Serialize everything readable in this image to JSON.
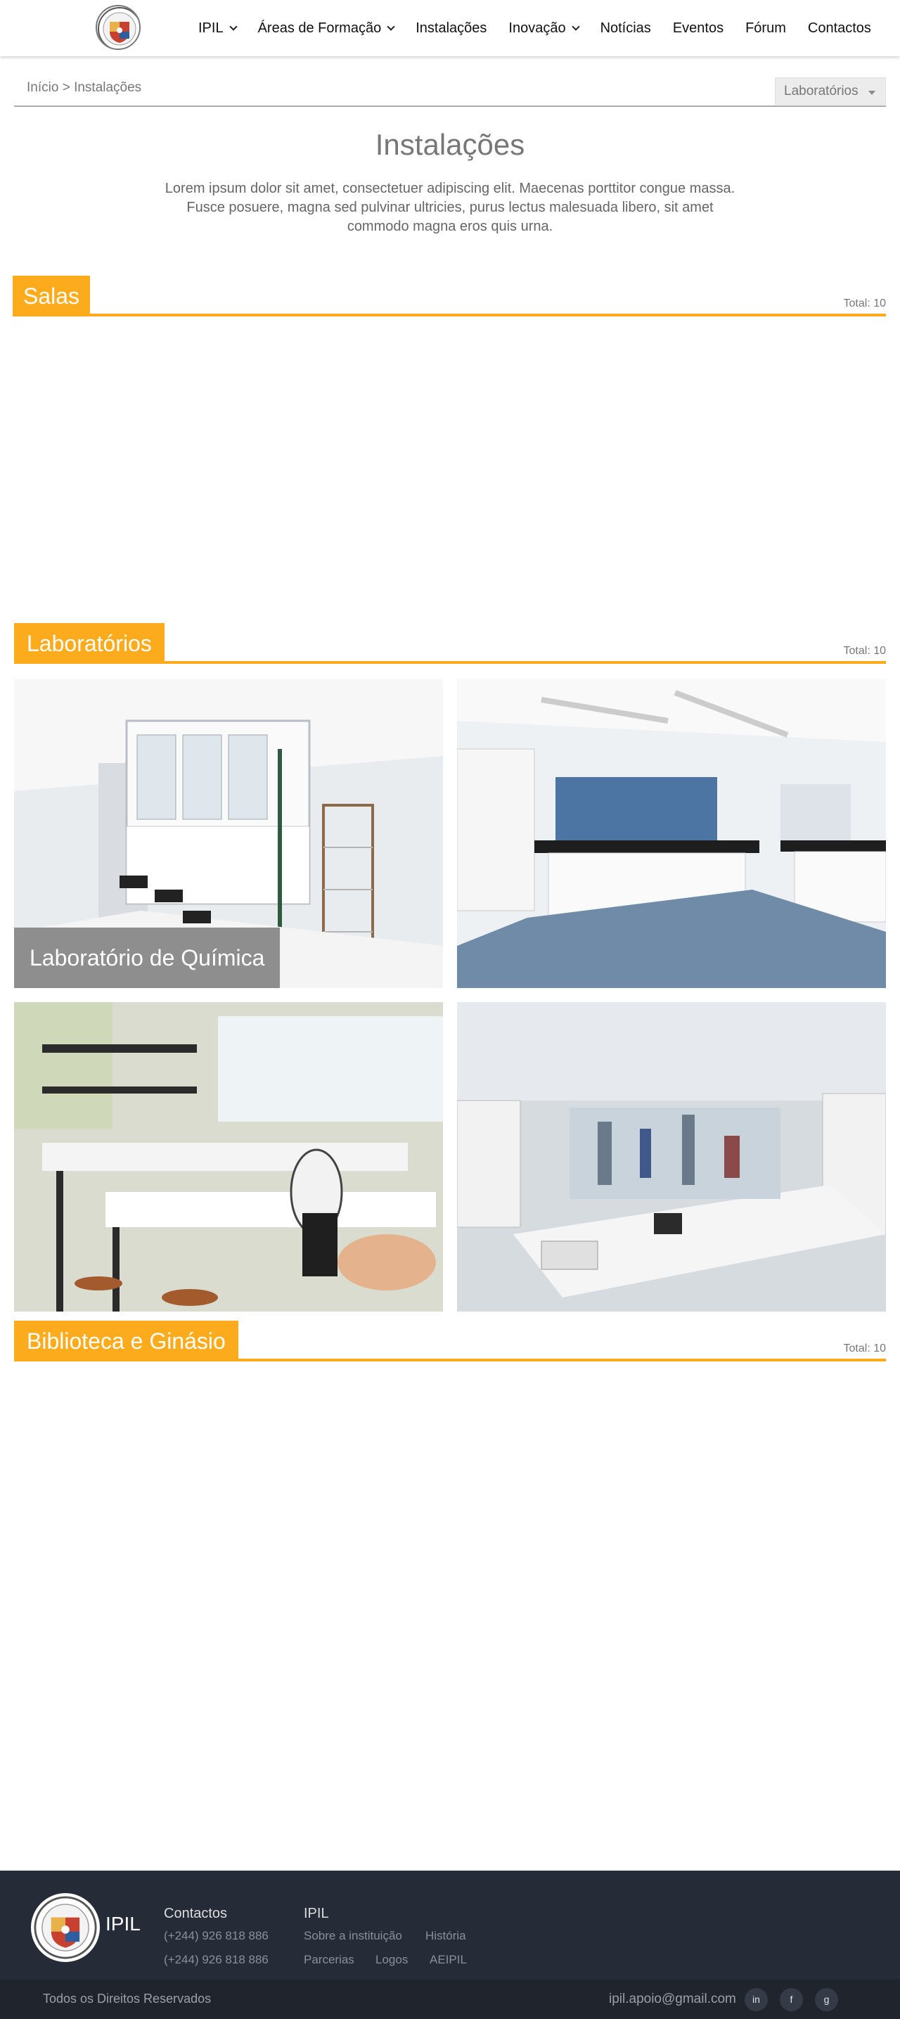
{
  "header": {
    "logo_icon": "ipil-crest-icon",
    "nav": [
      {
        "label": "IPIL",
        "has_dropdown": true
      },
      {
        "label": "Áreas de Formação",
        "has_dropdown": true
      },
      {
        "label": "Instalações",
        "has_dropdown": false
      },
      {
        "label": "Inovação",
        "has_dropdown": true
      },
      {
        "label": "Notícias",
        "has_dropdown": false
      },
      {
        "label": "Eventos",
        "has_dropdown": false
      },
      {
        "label": "Fórum",
        "has_dropdown": false
      },
      {
        "label": "Contactos",
        "has_dropdown": false
      }
    ]
  },
  "breadcrumb": "Início > Instalações",
  "filter": {
    "selected": "Laboratórios"
  },
  "page": {
    "title": "Instalações",
    "intro": "Lorem ipsum dolor sit amet, consectetuer adipiscing elit. Maecenas porttitor congue massa. Fusce posuere, magna sed pulvinar ultricies, purus lectus malesuada libero, sit amet commodo magna eros quis urna."
  },
  "sections": [
    {
      "title": "Salas",
      "total": "Total: 10"
    },
    {
      "title": "Laboratórios",
      "total": "Total: 10"
    },
    {
      "title": "Biblioteca e Ginásio",
      "total": "Total: 10"
    }
  ],
  "lab_cards": [
    {
      "caption": "Laboratório de Química"
    },
    {
      "caption": ""
    },
    {
      "caption": ""
    },
    {
      "caption": ""
    }
  ],
  "footer": {
    "brand": "IPIL",
    "contacts_title": "Contactos",
    "phones": [
      "(+244) 926 818 886",
      "(+244) 926 818 886"
    ],
    "ipil_title": "IPIL",
    "links": [
      "Sobre a instituição",
      "História",
      "Parcerias",
      "Logos",
      "AEIPIL"
    ],
    "copyright": "Todos os Direitos Reservados",
    "email": "ipil.apoio@gmail.com",
    "social": [
      {
        "icon": "linkedin-icon",
        "glyph": "in"
      },
      {
        "icon": "facebook-icon",
        "glyph": "f"
      },
      {
        "icon": "google-icon",
        "glyph": "g"
      }
    ]
  },
  "colors": {
    "accent": "#fbab1b",
    "footer_bg": "#262c37",
    "footer_bottom_bg": "#1f242d"
  }
}
